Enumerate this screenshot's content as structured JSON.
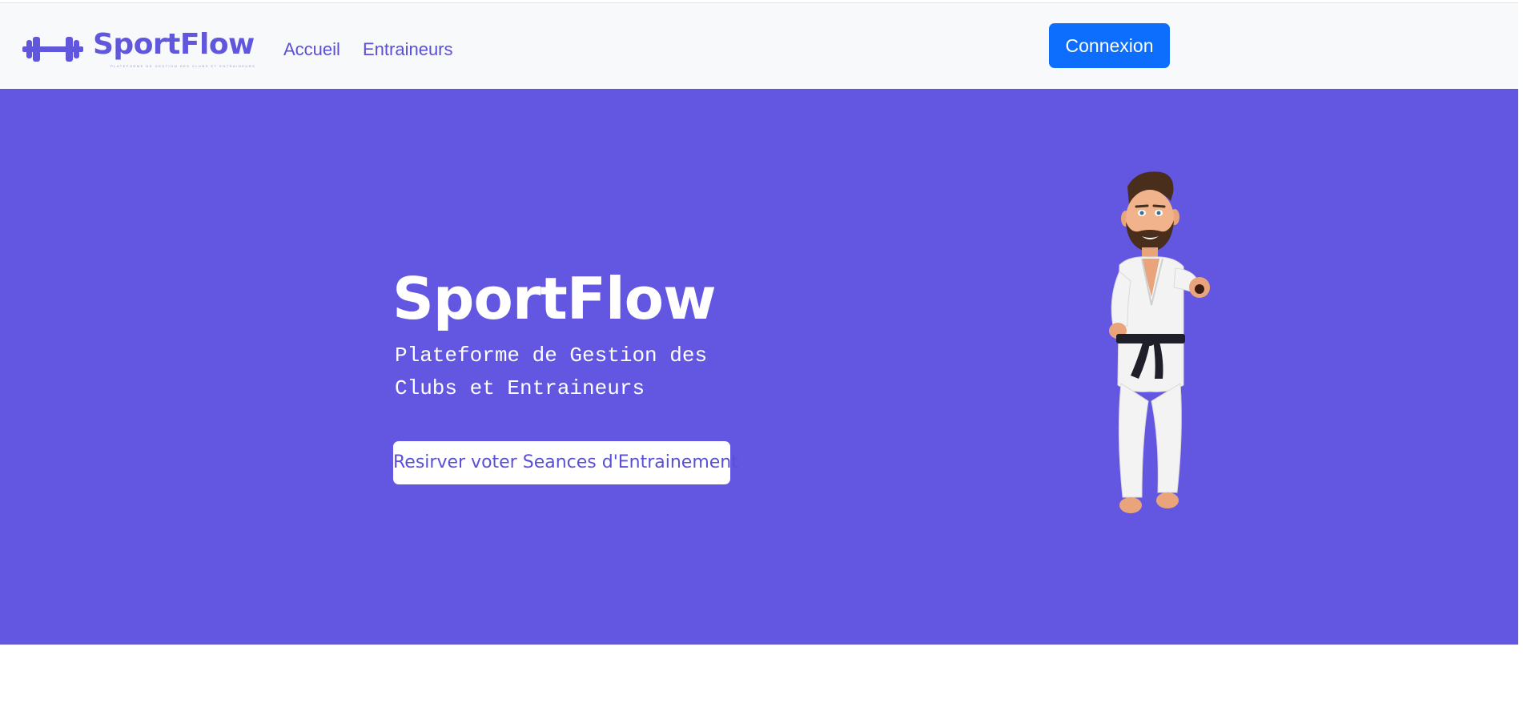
{
  "brand": {
    "name": "SportFlow",
    "tagline": "PLATEFORME DE GESTION DES CLUBS ET ENTRAINEURS",
    "logo_icon": "dumbbell-icon",
    "color": "#6157dd"
  },
  "nav": {
    "links": [
      {
        "label": "Accueil"
      },
      {
        "label": "Entraineurs"
      }
    ],
    "login_label": "Connexion",
    "login_color": "#0d6efd"
  },
  "hero": {
    "title": "SportFlow",
    "subtitle": "Plateforme de Gestion des Clubs et Entraineurs",
    "cta_label": "Resirver voter Seances d'Entrainement",
    "background": "#6357e2",
    "illustration": "karate-character-illustration"
  }
}
